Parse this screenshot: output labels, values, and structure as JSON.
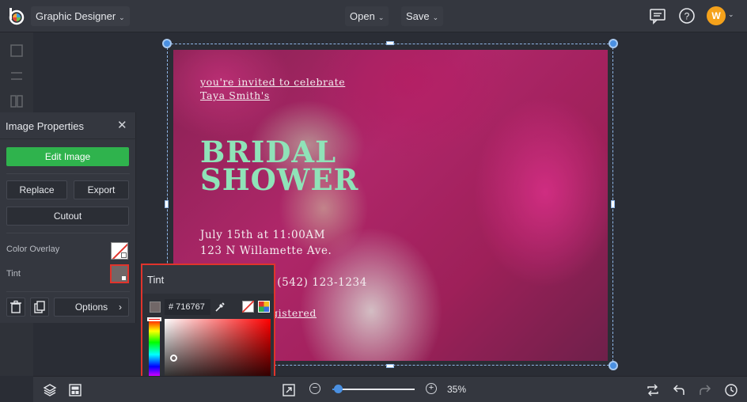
{
  "topbar": {
    "workspace_label": "Graphic Designer",
    "open_label": "Open",
    "save_label": "Save",
    "avatar_initial": "W"
  },
  "design": {
    "invite_line1": "you're invited to celebrate",
    "invite_line2": "Taya Smith's",
    "title_line1": "BRIDAL",
    "title_line2": "SHOWER",
    "date_line": "July 15th at 11:00AM",
    "address_line": "123 N Willamette Ave.",
    "rsvp_line": "A (542) 123-1234",
    "registry_line": "gistered"
  },
  "image_properties": {
    "title": "Image Properties",
    "edit_image_label": "Edit Image",
    "replace_label": "Replace",
    "export_label": "Export",
    "cutout_label": "Cutout",
    "color_overlay_label": "Color Overlay",
    "tint_label": "Tint",
    "options_label": "Options"
  },
  "tint_popup": {
    "title": "Tint",
    "hex_value": "# 716767",
    "current_color": "#716767"
  },
  "bottombar": {
    "zoom_percent": "35%",
    "zoom_level": 0.35
  },
  "colors": {
    "accent_green": "#2fb34d",
    "selection_blue": "#4a90e2",
    "highlight_red": "#e0342c",
    "title_mint": "#8fe3b8",
    "avatar_orange": "#f5a21b"
  }
}
